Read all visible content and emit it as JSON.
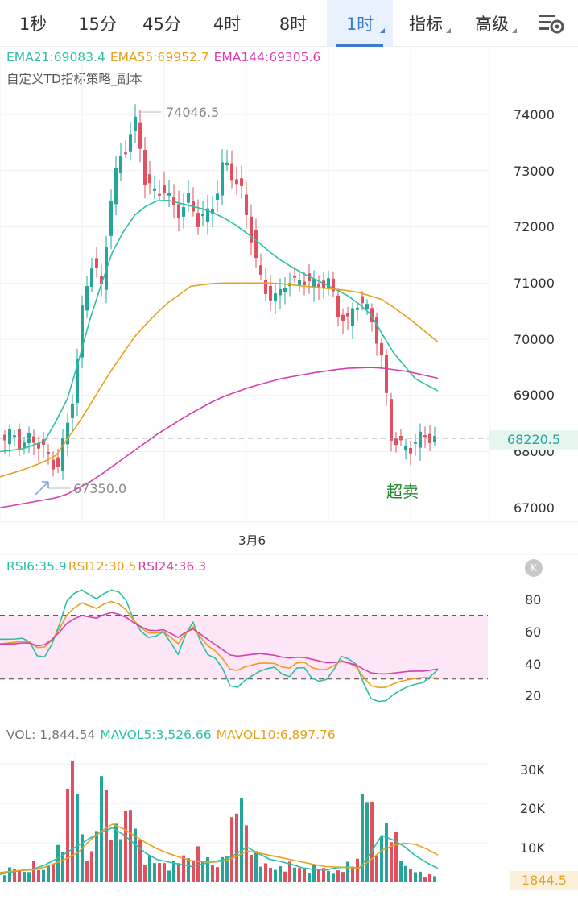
{
  "timeframe_tabs": [
    {
      "label": "1秒",
      "active": false,
      "dropdown": false
    },
    {
      "label": "15分",
      "active": false,
      "dropdown": false
    },
    {
      "label": "45分",
      "active": false,
      "dropdown": false
    },
    {
      "label": "4时",
      "active": false,
      "dropdown": false
    },
    {
      "label": "8时",
      "active": false,
      "dropdown": false
    },
    {
      "label": "1时",
      "active": true,
      "dropdown": true
    },
    {
      "label": "指标",
      "active": false,
      "dropdown": true
    },
    {
      "label": "高级",
      "active": false,
      "dropdown": true
    }
  ],
  "settings_icon": "chart-settings-icon",
  "main_chart": {
    "ema21": "EMA21:69083.4",
    "ema55": "EMA55:69952.7",
    "ema144": "EMA144:69305.6",
    "strategy": "自定义TD指标策略_副本",
    "price_ticks": [
      "74000",
      "73000",
      "72000",
      "71000",
      "70000",
      "69000",
      "68000",
      "67000"
    ],
    "current_price": "68220.5",
    "high_label": "74046.5",
    "low_label": "67350.0",
    "date_label": "3月6",
    "signal_label": "超卖"
  },
  "rsi": {
    "rsi6": "RSI6:35.9",
    "rsi12": "RSI12:30.5",
    "rsi24": "RSI24:36.3",
    "ticks": [
      "80",
      "60",
      "40",
      "20"
    ]
  },
  "volume": {
    "vol": "VOL: 1,844.54",
    "mavol5": "MAVOL5:3,526.66",
    "mavol10": "MAVOL10:6,897.76",
    "ticks": [
      "30K",
      "20K",
      "10K"
    ],
    "current": "1844.5"
  },
  "colors": {
    "up": "#26a69a",
    "down": "#e0505f",
    "ema21": "#2bc0a6",
    "ema55": "#e6a11d",
    "ema144": "#d63fae",
    "active_tab": "#3a7bd5"
  }
}
